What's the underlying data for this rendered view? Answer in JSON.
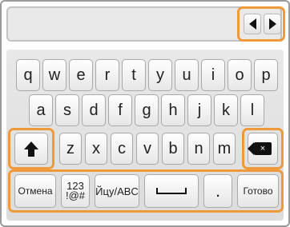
{
  "input": {
    "value": "",
    "placeholder": ""
  },
  "cursor": {
    "left_icon": "arrow-left-icon",
    "right_icon": "arrow-right-icon"
  },
  "keyboard": {
    "row1": [
      "q",
      "w",
      "e",
      "r",
      "t",
      "y",
      "u",
      "i",
      "o",
      "p"
    ],
    "row2": [
      "a",
      "s",
      "d",
      "f",
      "g",
      "h",
      "j",
      "k",
      "l"
    ],
    "row3": [
      "z",
      "x",
      "c",
      "v",
      "b",
      "n",
      "m"
    ],
    "shift_icon": "shift-up-arrow-icon",
    "backspace_icon": "backspace-icon",
    "backspace_glyph": "×",
    "cancel_label": "Отмена",
    "numbers_label_line1": "123",
    "numbers_label_line2": "!@#",
    "lang_label": "Йцу/ABC",
    "space_icon": "space-icon",
    "period_label": ".",
    "done_label": "Готово"
  },
  "colors": {
    "highlight": "#ef9a3a"
  }
}
